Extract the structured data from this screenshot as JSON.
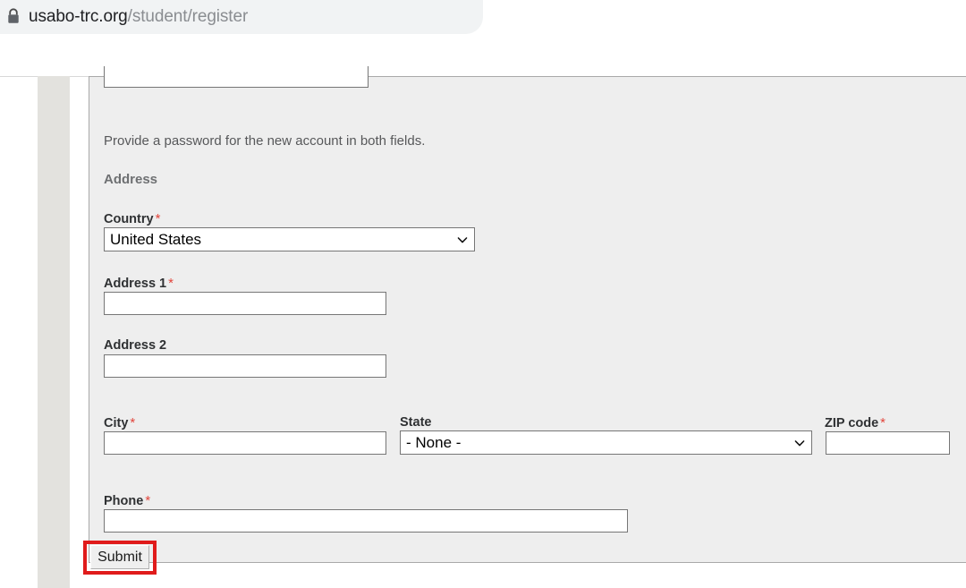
{
  "browser": {
    "lock_icon": "lock-icon",
    "url_domain": "usabo-trc.org",
    "url_path": "/student/register"
  },
  "form": {
    "password_help_text": "Provide a password for the new account in both fields.",
    "section_heading": "Address",
    "required_marker": "*",
    "fields": {
      "country": {
        "label": "Country",
        "required": true,
        "type": "select",
        "value": "United States",
        "chevron_icon": "chevron-down-icon"
      },
      "address1": {
        "label": "Address 1",
        "required": true,
        "type": "text",
        "value": "",
        "placeholder": ""
      },
      "address2": {
        "label": "Address 2",
        "required": false,
        "type": "text",
        "value": "",
        "placeholder": ""
      },
      "city": {
        "label": "City",
        "required": true,
        "type": "text",
        "value": "",
        "placeholder": ""
      },
      "state": {
        "label": "State",
        "required": false,
        "type": "select",
        "value": "- None -",
        "chevron_icon": "chevron-down-icon"
      },
      "zip": {
        "label": "ZIP code",
        "required": true,
        "type": "text",
        "value": "",
        "placeholder": ""
      },
      "phone": {
        "label": "Phone",
        "required": true,
        "type": "text",
        "value": "",
        "placeholder": ""
      }
    },
    "submit_label": "Submit"
  },
  "colors": {
    "required_asterisk": "#e2453c",
    "highlight_box": "#e01b1b",
    "panel_background": "#eeeeee",
    "url_domain_text": "#202124",
    "url_path_text": "#8a8d91"
  }
}
